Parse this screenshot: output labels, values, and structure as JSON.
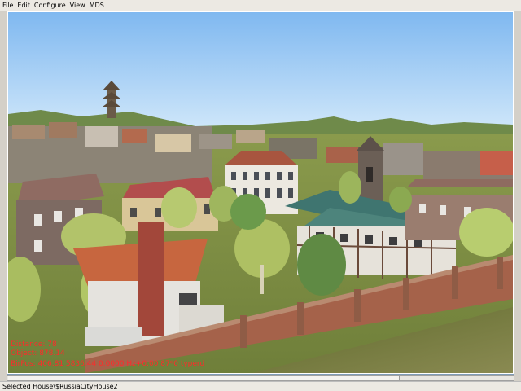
{
  "menu": {
    "items": [
      "File",
      "Edit",
      "Configure",
      "View",
      "MDS"
    ]
  },
  "hud": {
    "line1": "Distance: 78",
    "line2": "Object: 878.14",
    "line3": "BirPos: 406.81 5836.44 0.0000 Hz+0.00 87*0 typerd"
  },
  "status": {
    "text": "Selected House\\$RussiaCityHouse2"
  },
  "colors": {
    "sky_top": "#7fb8f0",
    "sky_bottom": "#d8ecfb",
    "hud_text": "#ff2a2a",
    "menubar": "#ece9e3"
  }
}
